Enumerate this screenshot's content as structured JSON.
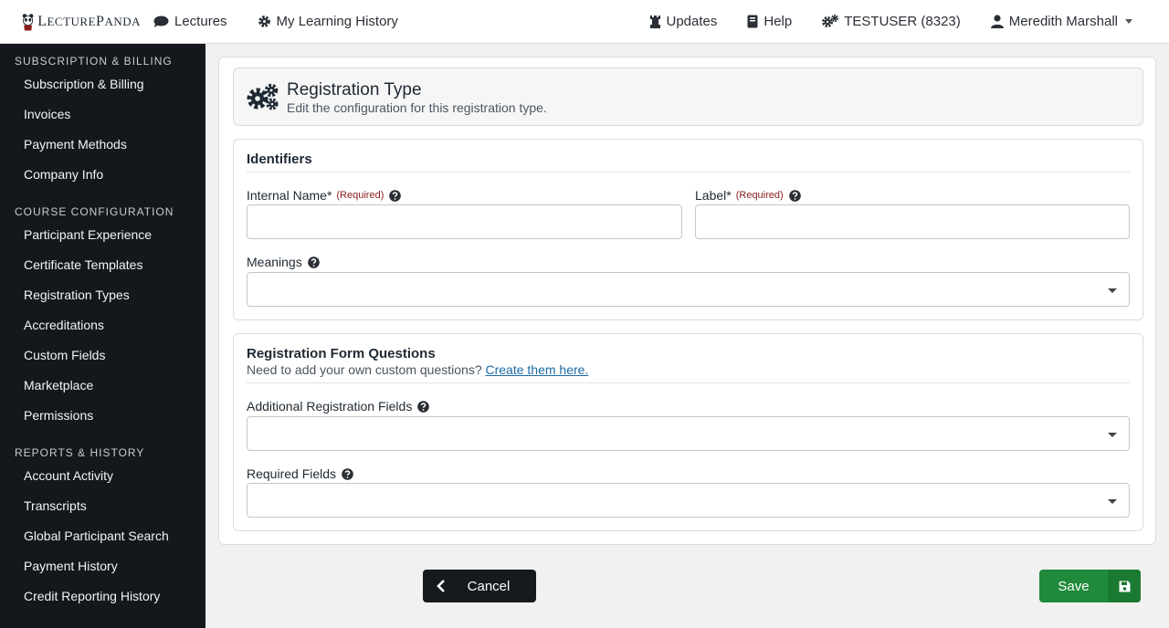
{
  "brand": {
    "name_big_l": "L",
    "name_rest1": "ECTURE",
    "name_big_p": "P",
    "name_rest2": "ANDA"
  },
  "nav": {
    "lectures": "Lectures",
    "history": "My Learning History",
    "updates": "Updates",
    "help": "Help",
    "account": "TESTUSER (8323)",
    "user": "Meredith Marshall"
  },
  "sidebar": {
    "sections": [
      {
        "title": "Subscription & Billing",
        "items": [
          "Subscription & Billing",
          "Invoices",
          "Payment Methods",
          "Company Info"
        ]
      },
      {
        "title": "Course Configuration",
        "items": [
          "Participant Experience",
          "Certificate Templates",
          "Registration Types",
          "Accreditations",
          "Custom Fields",
          "Marketplace",
          "Permissions"
        ]
      },
      {
        "title": "Reports & History",
        "items": [
          "Account Activity",
          "Transcripts",
          "Global Participant Search",
          "Payment History",
          "Credit Reporting History"
        ]
      }
    ]
  },
  "header": {
    "title": "Registration Type",
    "subtitle": "Edit the configuration for this registration type."
  },
  "identifiers": {
    "title": "Identifiers",
    "internal_name_label": "Internal Name",
    "label_label": "Label",
    "required_star": "*",
    "required_text": "(Required)",
    "internal_name_value": "",
    "label_value": "",
    "meanings_label": "Meanings"
  },
  "questions": {
    "title": "Registration Form Questions",
    "subtitle": "Need to add your own custom questions?",
    "link": "Create them here.",
    "additional_label": "Additional Registration Fields",
    "required_label": "Required Fields"
  },
  "footer": {
    "cancel": "Cancel",
    "save": "Save"
  },
  "colors": {
    "sidebar_bg": "#14181c",
    "save_green": "#1f8a3a",
    "link_blue": "#1b6aa5",
    "required_red": "#8a1c1c"
  }
}
